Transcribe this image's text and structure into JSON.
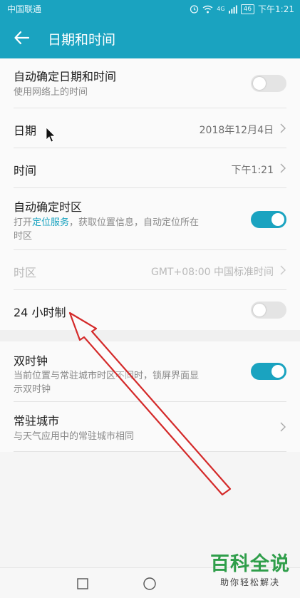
{
  "status_bar": {
    "carrier": "中国联通",
    "signal_text": "4G",
    "battery": "46",
    "time": "下午1:21"
  },
  "header": {
    "title": "日期和时间"
  },
  "settings": [
    {
      "label": "自动确定日期和时间",
      "subtitle": "使用网络上的时间",
      "toggle": "off"
    },
    {
      "label": "日期",
      "value": "2018年12月4日"
    },
    {
      "label": "时间",
      "value": "下午1:21"
    },
    {
      "label": "自动确定时区",
      "subtitle_prefix": "打开",
      "subtitle_link": "定位服务",
      "subtitle_suffix": "，获取位置信息，自动定位所在",
      "subtitle_line2": "时区",
      "toggle": "on"
    },
    {
      "label": "时区",
      "value": "GMT+08:00 中国标准时间",
      "disabled": true
    },
    {
      "label": "24 小时制",
      "toggle": "off"
    },
    {
      "label": "双时钟",
      "subtitle_line1": "当前位置与常驻城市时区不同时，锁屏界面显",
      "subtitle_line2": "示双时钟",
      "toggle": "on"
    },
    {
      "label": "常驻城市",
      "subtitle": "与天气应用中的常驻城市相同"
    }
  ],
  "watermark": {
    "title": "百科全说",
    "subtitle": "助你轻松解决"
  },
  "icons": [
    "back-arrow-icon",
    "chevron-right-icon",
    "alarm-icon",
    "wifi-icon",
    "mouse-cursor-icon",
    "recent-apps-icon",
    "home-icon"
  ],
  "colors": {
    "accent": "#1aa3c0",
    "annotation_arrow": "#d42a2a",
    "watermark_green": "#2f9e4a"
  }
}
